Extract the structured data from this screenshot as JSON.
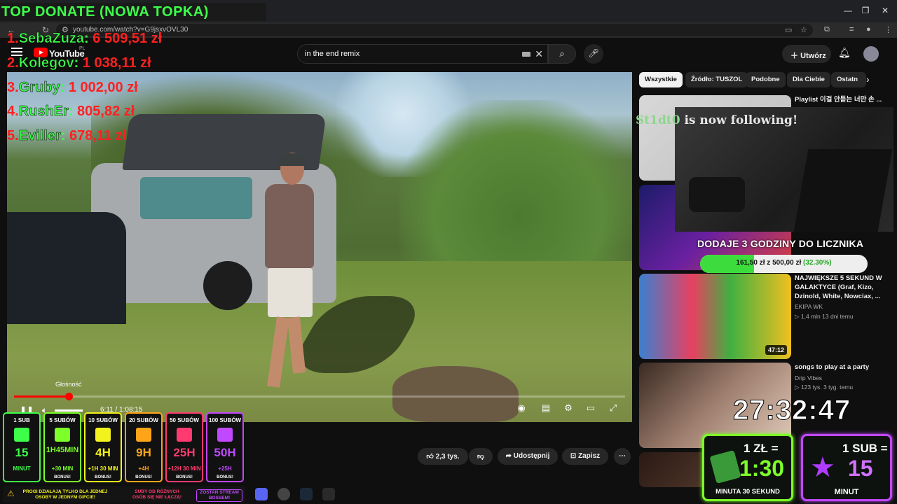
{
  "browser": {
    "url": "youtube.com/watch?v=G9jsxvOVL30"
  },
  "youtube": {
    "logo": "YouTube",
    "region": "PL",
    "search_value": "in the end remix",
    "create_label": "Utwórz"
  },
  "player": {
    "volume_tooltip": "Głośność",
    "time": "6:11 / 1:08:15",
    "progress_fraction": 0.09
  },
  "actions": {
    "likes": "2,3 tys.",
    "share": "Udostępnij",
    "save": "Zapisz"
  },
  "chips": [
    "Wszystkie",
    "Źródło: TUSZOL",
    "Podobne",
    "Dla Ciebie",
    "Ostatn"
  ],
  "recommendations": [
    {
      "title": "Playlist 이걸 안듣는 너만 손 ...",
      "channel": "",
      "meta": "",
      "duration": ""
    },
    {
      "title": "",
      "channel": "",
      "meta": "",
      "duration": ""
    },
    {
      "title": "NAJWIĘKSZE 5 SEKUND W GALAKTYCE (Graf, Kizo, Dzinold, White, Nowciax, ...",
      "channel": "EKIPA WK",
      "meta": "▷ 1,4 mln  13 dni temu",
      "duration": "47:12"
    },
    {
      "title": "songs to play at a party",
      "channel": "Drip Vibes",
      "meta": "▷ 123 tys.  3 tyg. temu",
      "duration": ""
    }
  ],
  "overlay": {
    "top_donate_title": "TOP DONATE (NOWA TOPKA)",
    "donors": [
      {
        "rank": "1.",
        "name": "SebaZuza",
        "amount": "6 509,51 zł"
      },
      {
        "rank": "2.",
        "name": "Kolegov",
        "amount": "1 038,11 zł"
      },
      {
        "rank": "3.",
        "name": "Gruby",
        "amount": "1 002,00 zł"
      },
      {
        "rank": "4.",
        "name": "RushEr",
        "amount": "805,82 zł"
      },
      {
        "rank": "5.",
        "name": "Eviller",
        "amount": "678,11 zł"
      }
    ],
    "follow_name": "St1dt0",
    "follow_text": " is now following!",
    "timer_goal_title": "DODAJE 3 GODZINY DO LICZNIKA",
    "timer_goal_progress": "161,50 zł z 500,00 zł",
    "timer_goal_pct": "(32.30%)",
    "timer_goal_fraction": 0.323,
    "countdown": "27:32:47",
    "rate_money_head": "1 ZŁ =",
    "rate_money_value": "1:30",
    "rate_money_foot": "MINUTA 30 SEKUND",
    "rate_sub_head": "1 SUB =",
    "rate_sub_value": "15",
    "rate_sub_foot": "MINUT",
    "tiers": [
      {
        "label": "1 SUB",
        "value": "15",
        "sub": "MINUT",
        "bonus": "",
        "color": "#3dff4a"
      },
      {
        "label": "5 SUBÓW",
        "value": "1H45MIN",
        "sub": "+30 MIN",
        "bonus": "BONUS!",
        "color": "#7dff2a"
      },
      {
        "label": "10 SUBÓW",
        "value": "4H",
        "sub": "+1H 30 MIN",
        "bonus": "BONUS!",
        "color": "#f2f21c"
      },
      {
        "label": "20 SUBÓW",
        "value": "9H",
        "sub": "+4H",
        "bonus": "BONUS!",
        "color": "#ffa418"
      },
      {
        "label": "50 SUBÓW",
        "value": "25H",
        "sub": "+12H 30 MIN",
        "bonus": "BONUS!",
        "color": "#ff3a70"
      },
      {
        "label": "100 SUBÓW",
        "value": "50H",
        "sub": "+25H",
        "bonus": "BONUS!",
        "color": "#c048ff"
      }
    ],
    "info_1": "PROGI DZIAŁAJĄ TYLKO DLA JEDNEJ OSOBY W JEDNYM GIFCIE!",
    "info_2": "SUBY OD RÓŻNYCH OSÓB SIĘ NIE ŁĄCZĄ!",
    "info_3": "ZOSTAŃ STREAM BOSSEM!"
  }
}
